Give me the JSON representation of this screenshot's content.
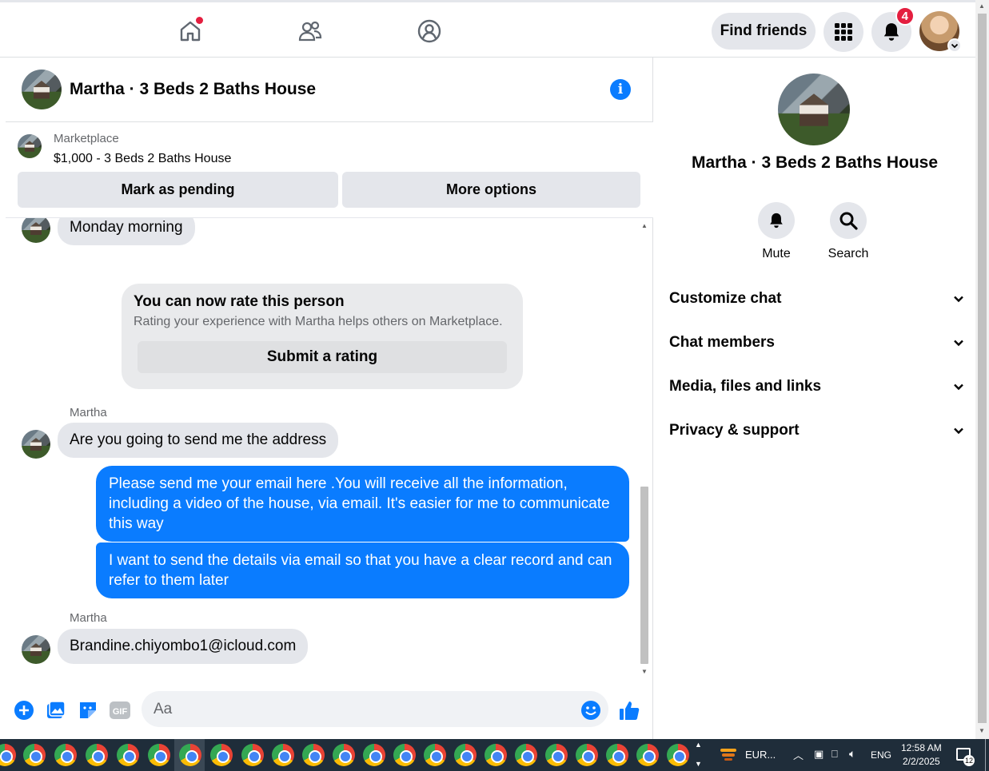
{
  "topnav": {
    "find_friends": "Find friends",
    "notif_count": "4",
    "icons": [
      "home-icon",
      "friends-icon",
      "groups-icon",
      "menu-grid-icon",
      "bell-icon"
    ]
  },
  "chat": {
    "title": "Martha · 3 Beds 2 Baths House",
    "marketplace_label": "Marketplace",
    "listing": "$1,000 - 3 Beds 2 Baths House",
    "mark_pending": "Mark as pending",
    "more_options": "More options",
    "messages": {
      "m1": "Monday morning",
      "rate_title": "You can now rate this person",
      "rate_sub": "Rating your experience with Martha helps others on Marketplace.",
      "rate_button": "Submit a rating",
      "sender1": "Martha",
      "m2": "Are you going to send me the address",
      "out1": "Please send me your email here .You will receive all the information, including a video of the house, via email. It's easier for me to communicate this way",
      "out2": "I want to send the details via email so that you have a clear record and can refer to them later",
      "sender2": "Martha",
      "m3": "Brandine.chiyombo1@icloud.com"
    },
    "composer_placeholder": "Aa"
  },
  "panel": {
    "name": "Martha · 3 Beds 2 Baths House",
    "mute": "Mute",
    "search": "Search",
    "rows": [
      "Customize chat",
      "Chat members",
      "Media, files and links",
      "Privacy & support"
    ]
  },
  "taskbar": {
    "weather": "EUR...",
    "lang": "ENG",
    "time": "12:58 AM",
    "date": "2/2/2025",
    "notif": "12"
  },
  "colors": {
    "accent": "#0a7cff",
    "badge": "#e41e3f",
    "bubble_gray": "#e4e6eb"
  }
}
